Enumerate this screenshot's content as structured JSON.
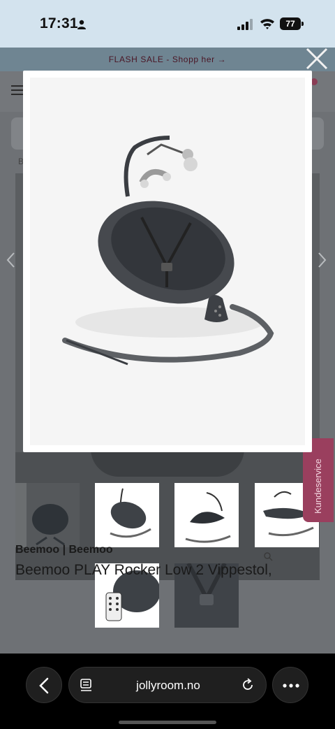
{
  "status_bar": {
    "time": "17:31",
    "battery": "77"
  },
  "banner": {
    "text": "FLASH SALE - Shopp her →"
  },
  "product": {
    "brand": "Beemoo | Beemoo",
    "title": "Beemoo PLAY Rocker Low 2 Vippestol,"
  },
  "side_tab": {
    "label": "Kundeservice"
  },
  "browser": {
    "url": "jollyroom.no"
  },
  "colors": {
    "accent": "#9a3f5e",
    "banner_text": "#4a1524"
  },
  "icons": [
    "person-icon",
    "signal-icon",
    "wifi-icon",
    "battery-icon",
    "close-icon",
    "menu-icon",
    "chevron-left-icon",
    "chevron-right-icon",
    "zoom-icon",
    "reader-icon",
    "reload-icon",
    "more-icon",
    "back-icon"
  ]
}
